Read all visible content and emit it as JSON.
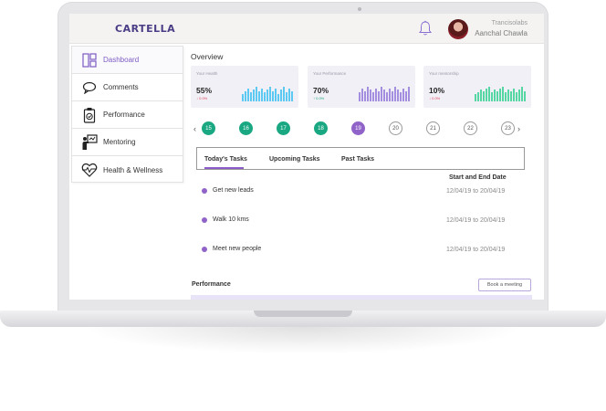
{
  "header": {
    "brand": "CARTELLA",
    "user_company": "Trancisolabs",
    "user_name": "Aanchal Chawla"
  },
  "sidebar": {
    "items": [
      {
        "label": "Dashboard",
        "icon": "dashboard-icon",
        "active": true
      },
      {
        "label": "Comments",
        "icon": "comment-icon"
      },
      {
        "label": "Performance",
        "icon": "clipboard-icon"
      },
      {
        "label": "Mentoring",
        "icon": "presenter-icon"
      },
      {
        "label": "Health & Wellness",
        "icon": "heart-pulse-icon"
      }
    ]
  },
  "overview": {
    "title": "Overview",
    "cards": [
      {
        "label": "Your Health",
        "value": "55%",
        "delta": "↓ 0.0%",
        "direction": "down",
        "color": "#5cc9f2",
        "bars": [
          0.5,
          0.7,
          0.9,
          0.6,
          0.8,
          1,
          0.7,
          0.9,
          0.6,
          0.8,
          1,
          0.7,
          0.9,
          0.5,
          0.8,
          1,
          0.6,
          0.9,
          0.7
        ]
      },
      {
        "label": "Your Performance",
        "value": "70%",
        "delta": "↑ 0.0%",
        "direction": "up",
        "color": "#a48ee0",
        "bars": [
          0.6,
          0.9,
          0.7,
          1,
          0.8,
          0.6,
          0.9,
          0.7,
          1,
          0.8,
          0.6,
          0.9,
          0.7,
          1,
          0.8,
          0.6,
          0.9,
          0.7,
          1
        ]
      },
      {
        "label": "Your mentorship",
        "value": "10%",
        "delta": "↓ 0.0%",
        "direction": "down",
        "color": "#56d6a2",
        "bars": [
          0.5,
          0.6,
          0.8,
          0.7,
          0.9,
          1,
          0.6,
          0.8,
          0.7,
          0.9,
          1,
          0.6,
          0.8,
          0.7,
          0.9,
          0.6,
          0.8,
          1,
          0.7
        ]
      }
    ]
  },
  "dates": {
    "prev_icon": "chevron-left-icon",
    "next_icon": "chevron-right-icon",
    "days": [
      {
        "day": "15",
        "state": "past"
      },
      {
        "day": "16",
        "state": "past"
      },
      {
        "day": "17",
        "state": "past"
      },
      {
        "day": "18",
        "state": "past"
      },
      {
        "day": "19",
        "state": "today"
      },
      {
        "day": "20",
        "state": "future"
      },
      {
        "day": "21",
        "state": "future"
      },
      {
        "day": "22",
        "state": "future"
      },
      {
        "day": "23",
        "state": "future"
      }
    ]
  },
  "tasks": {
    "tabs": [
      "Today's Tasks",
      "Upcoming Tasks",
      "Past  Tasks"
    ],
    "active_tab": 0,
    "date_header": "Start and End Date",
    "items": [
      {
        "name": "Get new leads",
        "dates": "12/04/19 to 20/04/19"
      },
      {
        "name": "Walk 10 kms",
        "dates": "12/04/19 to 20/04/19"
      },
      {
        "name": "Meet new people",
        "dates": "12/04/19 to 20/04/19"
      }
    ]
  },
  "performance": {
    "title": "Performance",
    "button": "Book a meeting"
  },
  "colors": {
    "brand": "#4a3c85",
    "accent": "#9063c9",
    "done": "#1aa883"
  }
}
